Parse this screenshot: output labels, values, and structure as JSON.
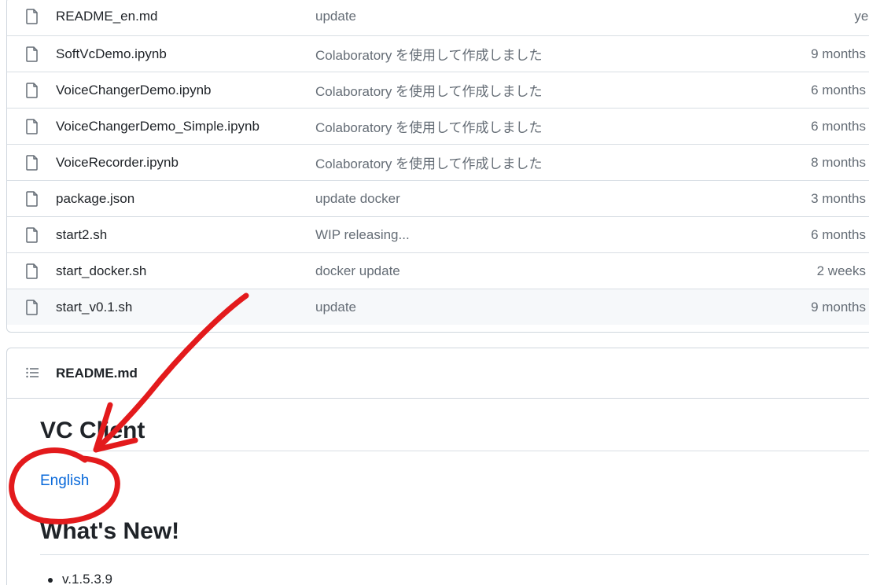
{
  "files": [
    {
      "name": "README_en.md",
      "commit": "update",
      "date": "yeste"
    },
    {
      "name": "SoftVcDemo.ipynb",
      "commit": "Colaboratory を使用して作成しました",
      "date": "9 months"
    },
    {
      "name": "VoiceChangerDemo.ipynb",
      "commit": "Colaboratory を使用して作成しました",
      "date": "6 months"
    },
    {
      "name": "VoiceChangerDemo_Simple.ipynb",
      "commit": "Colaboratory を使用して作成しました",
      "date": "6 months"
    },
    {
      "name": "VoiceRecorder.ipynb",
      "commit": "Colaboratory を使用して作成しました",
      "date": "8 months"
    },
    {
      "name": "package.json",
      "commit": "update docker",
      "date": "3 months"
    },
    {
      "name": "start2.sh",
      "commit": "WIP releasing...",
      "date": "6 months"
    },
    {
      "name": "start_docker.sh",
      "commit": "docker update",
      "date": "2 weeks"
    },
    {
      "name": "start_v0.1.sh",
      "commit": "update",
      "date": "9 months"
    }
  ],
  "readme": {
    "title": "README.md",
    "heading": "VC Client",
    "language_link": "English",
    "section_heading": "What's New!",
    "list_items": [
      "v.1.5.3.9"
    ]
  },
  "icons": {
    "file": "file-icon",
    "list": "list-unordered-icon"
  },
  "colors": {
    "link": "#0969da",
    "annotation": "#e31a1c"
  }
}
